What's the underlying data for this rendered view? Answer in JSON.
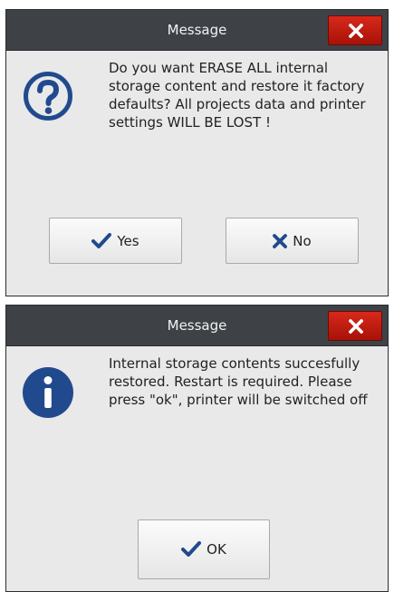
{
  "dialog1": {
    "title": "Message",
    "icon": "question-icon",
    "message": "Do you want ERASE ALL internal storage content and restore it factory defaults? All projects data and printer settings WILL BE LOST !",
    "yes_label": "Yes",
    "no_label": "No"
  },
  "dialog2": {
    "title": "Message",
    "icon": "info-icon",
    "message": "Internal storage contents succesfully restored. Restart is required. Please press \"ok\", printer will be switched off",
    "ok_label": "OK"
  },
  "colors": {
    "titlebar": "#3e4246",
    "close_button": "#c2200f",
    "icon_blue": "#214a8e",
    "dialog_background": "#e9e9e9"
  }
}
